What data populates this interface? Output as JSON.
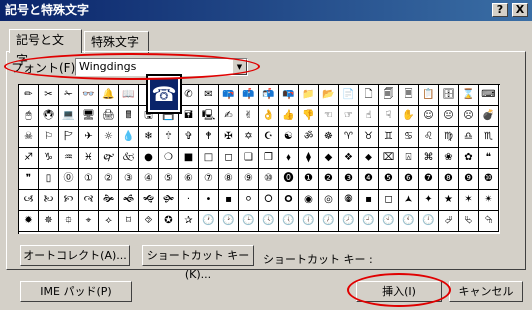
{
  "window": {
    "title": "記号と特殊文字",
    "help_label": "?",
    "close_label": "X"
  },
  "tabs": [
    {
      "label": "記号と文字"
    },
    {
      "label": "特殊文字"
    }
  ],
  "font": {
    "label": "フォント(F):",
    "value": "Wingdings"
  },
  "symbols": [
    "✏",
    "✂",
    "✁",
    "👓",
    "🔔",
    "📖",
    "🕯",
    "☎",
    "✆",
    "✉",
    "📪",
    "📫",
    "📬",
    "📭",
    "📁",
    "📂",
    "📄",
    "🗋",
    "🗐",
    "🗏",
    "📋",
    "🗄",
    "⌛",
    "⌨",
    "🖱",
    "🖲",
    "💻",
    "🖥",
    "🖨",
    "🖩",
    "🖫",
    "💾",
    "🖬",
    "🖳",
    "✍",
    "✌",
    "👌",
    "👍",
    "👎",
    "☜",
    "☞",
    "☝",
    "☟",
    "✋",
    "☺",
    "😐",
    "☹",
    "💣",
    "☠",
    "⚐",
    "🏱",
    "✈",
    "☼",
    "💧",
    "❄",
    "🕆",
    "✞",
    "🕈",
    "✠",
    "✡",
    "☪",
    "☯",
    "ॐ",
    "☸",
    "♈",
    "♉",
    "♊",
    "♋",
    "♌",
    "♍",
    "♎",
    "♏",
    "♐",
    "♑",
    "♒",
    "♓",
    "🙰",
    "🙵",
    "●",
    "❍",
    "■",
    "□",
    "◻",
    "❑",
    "❒",
    "⬧",
    "⧫",
    "◆",
    "❖",
    "⬥",
    "⌧",
    "⍓",
    "⌘",
    "❀",
    "✿",
    "❝",
    "❞",
    "▯",
    "⓪",
    "①",
    "②",
    "③",
    "④",
    "⑤",
    "⑥",
    "⑦",
    "⑧",
    "⑨",
    "⑩",
    "⓿",
    "❶",
    "❷",
    "❸",
    "❹",
    "❺",
    "❻",
    "❼",
    "❽",
    "❾",
    "❿",
    "🙢",
    "🙠",
    "🙡",
    "🙣",
    "🙞",
    "🙜",
    "🙝",
    "🙟",
    "·",
    "•",
    "▪",
    "⚪",
    "🞆",
    "🞈",
    "◉",
    "◎",
    "🞋",
    "▪",
    "◻",
    "🟂",
    "✦",
    "★",
    "✶",
    "✴",
    "✹",
    "✵",
    "⯐",
    "⌖",
    "⟡",
    "⌑",
    "⯑",
    "✪",
    "✰",
    "🕐",
    "🕑",
    "🕒",
    "🕓",
    "🕔",
    "🕕",
    "🕖",
    "🕗",
    "🕘",
    "🕙",
    "🕚",
    "🕛",
    "⮰",
    "⮱",
    "⮲"
  ],
  "buttons": {
    "autocorrect": "オートコレクト(A)...",
    "shortcut_key": "ショートカット キー(K)...",
    "shortcut_label": "ショートカット キー :",
    "ime_pad": "IME パッド(P)",
    "insert": "挿入(I)",
    "cancel": "キャンセル"
  },
  "zoom_preview": {
    "symbol": "☎"
  },
  "annotation_color": "#e00000"
}
